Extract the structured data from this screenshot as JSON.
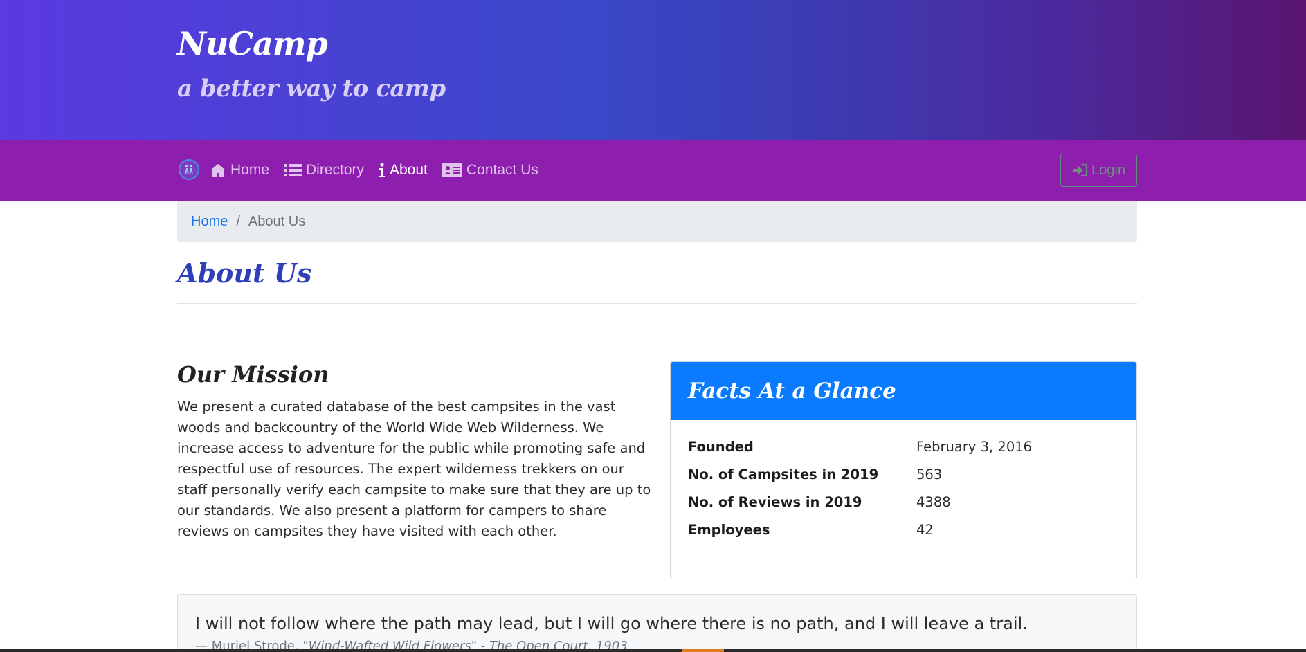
{
  "header": {
    "brand": "NuCamp",
    "tagline": "a better way to camp"
  },
  "nav": {
    "logo_icon": "campers-logo-icon",
    "items": [
      {
        "label": "Home",
        "icon": "home-icon",
        "active": false
      },
      {
        "label": "Directory",
        "icon": "list-icon",
        "active": false
      },
      {
        "label": "About",
        "icon": "info-icon",
        "active": true
      },
      {
        "label": "Contact Us",
        "icon": "address-card-icon",
        "active": false
      }
    ],
    "login_label": "Login",
    "login_icon": "sign-in-icon"
  },
  "breadcrumb": {
    "home": "Home",
    "separator": "/",
    "current": "About Us"
  },
  "page": {
    "title": "About Us"
  },
  "mission": {
    "heading": "Our Mission",
    "text": "We present a curated database of the best campsites in the vast woods and backcountry of the World Wide Web Wilderness. We increase access to adventure for the public while promoting safe and respectful use of resources. The expert wilderness trekkers on our staff personally verify each campsite to make sure that they are up to our standards. We also present a platform for campers to share reviews on campsites they have visited with each other."
  },
  "facts": {
    "heading": "Facts At a Glance",
    "rows": [
      {
        "label": "Founded",
        "value": "February 3, 2016"
      },
      {
        "label": "No. of Campsites in 2019",
        "value": "563"
      },
      {
        "label": "No. of Reviews in 2019",
        "value": "4388"
      },
      {
        "label": "Employees",
        "value": "42"
      }
    ]
  },
  "quote": {
    "text": "I will not follow where the path may lead, but I will go where there is no path, and I will leave a trail.",
    "author": "— Muriel Strode,",
    "source": "\"Wind-Wafted Wild Flowers\" - The Open Court, 1903"
  },
  "colors": {
    "header_gradient_start": "#5b3ae0",
    "header_gradient_end": "#5a1570",
    "navbar": "#8e1eae",
    "facts_header": "#0a7bff",
    "title": "#2f3fb8",
    "link": "#1a73e8"
  }
}
